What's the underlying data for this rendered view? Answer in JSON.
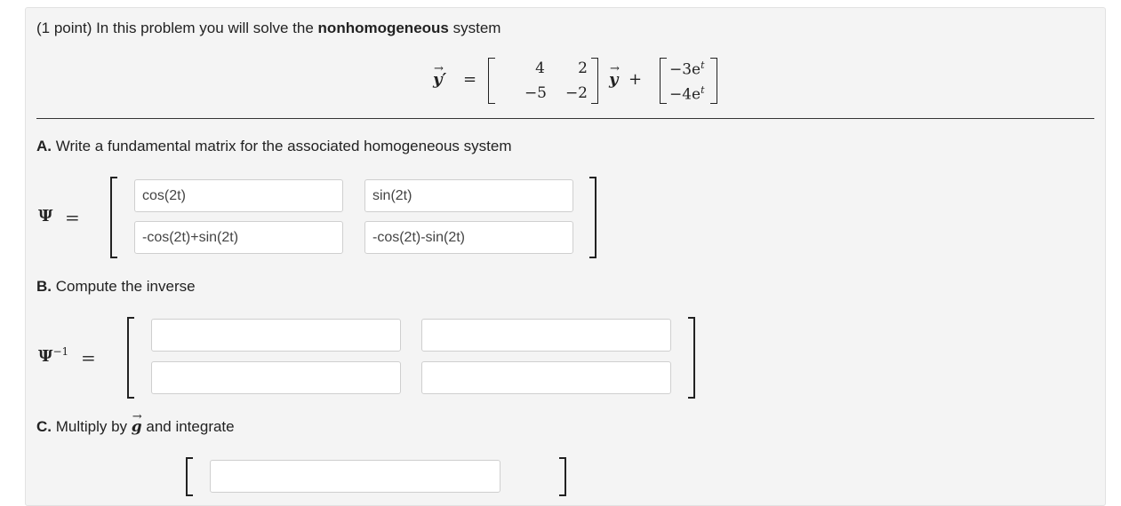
{
  "problem": {
    "intro_prefix": "(1 point) In this problem you will solve the ",
    "intro_bold": "nonhomogeneous",
    "intro_suffix": " system"
  },
  "equation": {
    "lhs": "y′",
    "equals": "=",
    "matrix": [
      [
        "4",
        "2"
      ],
      [
        "−5",
        "−2"
      ]
    ],
    "y": "y",
    "plus": "+",
    "forcing": [
      "−3e",
      "−4e"
    ],
    "exp": "t"
  },
  "partA": {
    "letter": "A.",
    "text": " Write a fundamental matrix for the associated homogeneous system",
    "symbol": "Ψ",
    "equals": "=",
    "entries": [
      "cos(2t)",
      "sin(2t)",
      "-cos(2t)+sin(2t)",
      "-cos(2t)-sin(2t)"
    ]
  },
  "partB": {
    "letter": "B.",
    "text": " Compute the inverse",
    "symbol": "Ψ",
    "sup": "−1",
    "equals": "=",
    "entries": [
      "",
      "",
      "",
      ""
    ]
  },
  "partC": {
    "letter": "C.",
    "text_prefix": " Multiply by ",
    "g": "g",
    "text_suffix": " and integrate"
  }
}
